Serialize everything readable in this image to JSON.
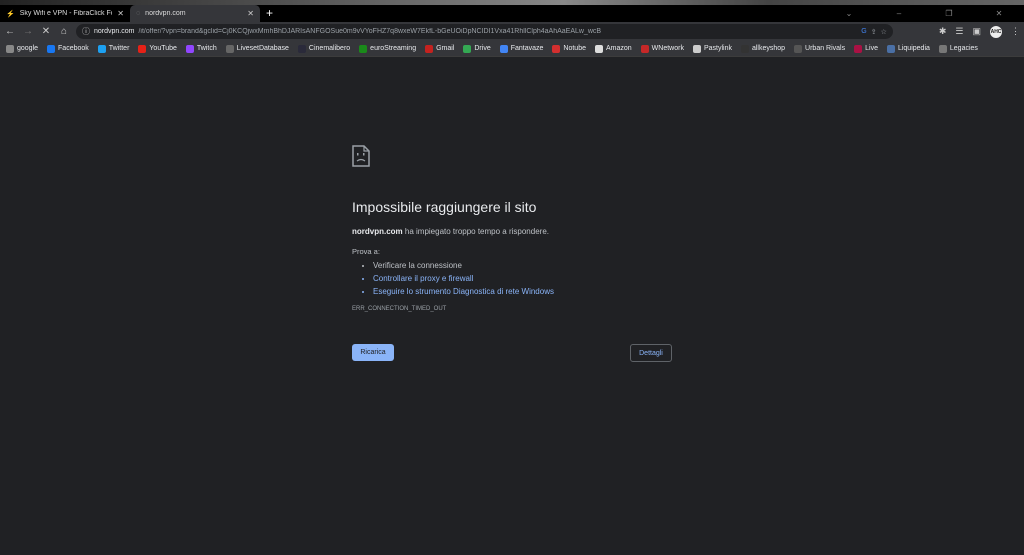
{
  "tabs": [
    {
      "title": "Sky Wifi e VPN - FibraClick Forum",
      "icon": "bolt-icon",
      "active": false
    },
    {
      "title": "nordvpn.com",
      "icon": "loading-spinner-icon",
      "active": true
    }
  ],
  "omnibox": {
    "host": "nordvpn.com",
    "path": "/it/offer/?vpn=brand&gclid=Cj0KCQjwxMmhBhDJARIsANFGOSue0m9vVYoFHZ7q8wxeW7EkfL-bGeUOiDpNCIDI1Vxa41RhllClph4aAhAaEALw_wcB"
  },
  "profile": {
    "initials": "AHC"
  },
  "bookmarks": [
    {
      "label": "google",
      "color": "#888"
    },
    {
      "label": "Facebook",
      "color": "#1877f2"
    },
    {
      "label": "Twitter",
      "color": "#1da1f2"
    },
    {
      "label": "YouTube",
      "color": "#e62117"
    },
    {
      "label": "Twitch",
      "color": "#9146ff"
    },
    {
      "label": "LivesetDatabase",
      "color": "#666"
    },
    {
      "label": "Cinemalibero",
      "color": "#2a2a3a"
    },
    {
      "label": "euroStreaming",
      "color": "#1a8a1a"
    },
    {
      "label": "Gmail",
      "color": "#c5221f"
    },
    {
      "label": "Drive",
      "color": "#34a853"
    },
    {
      "label": "Fantavaze",
      "color": "#4285f4"
    },
    {
      "label": "Notube",
      "color": "#d32f2f"
    },
    {
      "label": "Amazon",
      "color": "#ddd"
    },
    {
      "label": "WNetwork",
      "color": "#c62828"
    },
    {
      "label": "Pastylink",
      "color": "#ccc"
    },
    {
      "label": "allkeyshop",
      "color": "#333"
    },
    {
      "label": "Urban Rivals",
      "color": "#555"
    },
    {
      "label": "Live",
      "color": "#a14"
    },
    {
      "label": "Liquipedia",
      "color": "#4a6fa5"
    },
    {
      "label": "Legacies",
      "color": "#777"
    }
  ],
  "error": {
    "title": "Impossibile raggiungere il sito",
    "host": "nordvpn.com",
    "desc": " ha impiegato troppo tempo a rispondere.",
    "try": "Prova a:",
    "suggestions": [
      "Verificare la connessione",
      "Controllare il proxy e firewall",
      "Eseguire lo strumento Diagnostica di rete Windows"
    ],
    "code": "ERR_CONNECTION_TIMED_OUT",
    "reload": "Ricarica",
    "details": "Dettagli"
  }
}
